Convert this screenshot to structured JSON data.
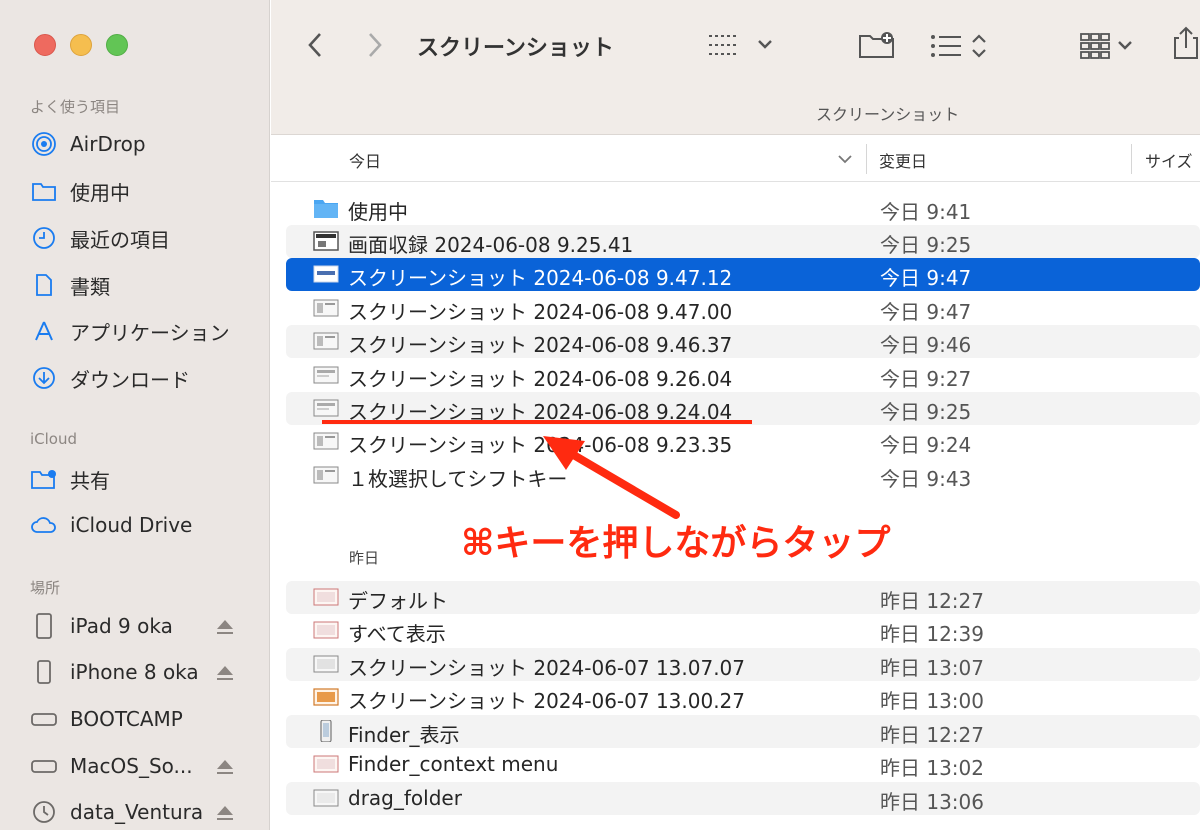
{
  "window": {
    "title": "スクリーンショット",
    "path_label": "スクリーンショット"
  },
  "sidebar": {
    "favorites_label": "よく使う項目",
    "icloud_label": "iCloud",
    "places_label": "場所",
    "favorites": [
      {
        "label": "AirDrop",
        "icon": "airdrop-icon"
      },
      {
        "label": "使用中",
        "icon": "folder-icon"
      },
      {
        "label": "最近の項目",
        "icon": "clock-icon"
      },
      {
        "label": "書類",
        "icon": "document-icon"
      },
      {
        "label": "アプリケーション",
        "icon": "applications-icon"
      },
      {
        "label": "ダウンロード",
        "icon": "download-icon"
      }
    ],
    "icloud": [
      {
        "label": "共有",
        "icon": "shared-folder-icon"
      },
      {
        "label": "iCloud Drive",
        "icon": "cloud-icon"
      }
    ],
    "places": [
      {
        "label": "iPad 9 oka",
        "icon": "ipad-icon",
        "eject": true
      },
      {
        "label": "iPhone 8 oka",
        "icon": "iphone-icon",
        "eject": true
      },
      {
        "label": "BOOTCAMP",
        "icon": "disk-icon",
        "eject": false
      },
      {
        "label": "MacOS_So...",
        "icon": "disk-icon",
        "eject": true
      },
      {
        "label": "data_Ventura",
        "icon": "time-machine-icon",
        "eject": true
      }
    ]
  },
  "columns": {
    "name": "今日",
    "modified": "変更日",
    "size": "サイズ"
  },
  "groups": {
    "today": "今日",
    "yesterday": "昨日"
  },
  "files_today": [
    {
      "name": "使用中",
      "date": "今日 9:41",
      "kind": "folder"
    },
    {
      "name": "画面収録 2024-06-08 9.25.41",
      "date": "今日 9:25",
      "kind": "movie"
    },
    {
      "name": "スクリーンショット 2024-06-08 9.47.12",
      "date": "今日 9:47",
      "kind": "image",
      "selected": true
    },
    {
      "name": "スクリーンショット 2024-06-08 9.47.00",
      "date": "今日 9:47",
      "kind": "image"
    },
    {
      "name": "スクリーンショット 2024-06-08 9.46.37",
      "date": "今日 9:46",
      "kind": "image"
    },
    {
      "name": "スクリーンショット 2024-06-08 9.26.04",
      "date": "今日 9:27",
      "kind": "image"
    },
    {
      "name": "スクリーンショット 2024-06-08 9.24.04",
      "date": "今日 9:25",
      "kind": "image"
    },
    {
      "name": "スクリーンショット 2024-06-08 9.23.35",
      "date": "今日 9:24",
      "kind": "image"
    },
    {
      "name": "１枚選択してシフトキー",
      "date": "今日 9:43",
      "kind": "image"
    }
  ],
  "files_yesterday": [
    {
      "name": "デフォルト",
      "date": "昨日 12:27",
      "kind": "image"
    },
    {
      "name": "すべて表示",
      "date": "昨日 12:39",
      "kind": "image"
    },
    {
      "name": "スクリーンショット 2024-06-07 13.07.07",
      "date": "昨日 13:07",
      "kind": "image"
    },
    {
      "name": "スクリーンショット 2024-06-07 13.00.27",
      "date": "昨日 13:00",
      "kind": "image"
    },
    {
      "name": "Finder_表示",
      "date": "昨日 12:27",
      "kind": "phone"
    },
    {
      "name": "Finder_context menu",
      "date": "昨日 13:02",
      "kind": "image"
    },
    {
      "name": "drag_folder",
      "date": "昨日 13:06",
      "kind": "image"
    }
  ],
  "annotation": {
    "text": "⌘キーを押しながらタップ",
    "color": "#ff2a10"
  },
  "colors": {
    "selection": "#0a63d8",
    "sidebar_bg": "#ebe6e3",
    "toolbar_bg": "#f1ece8",
    "accent_icon": "#1a7cf0"
  }
}
